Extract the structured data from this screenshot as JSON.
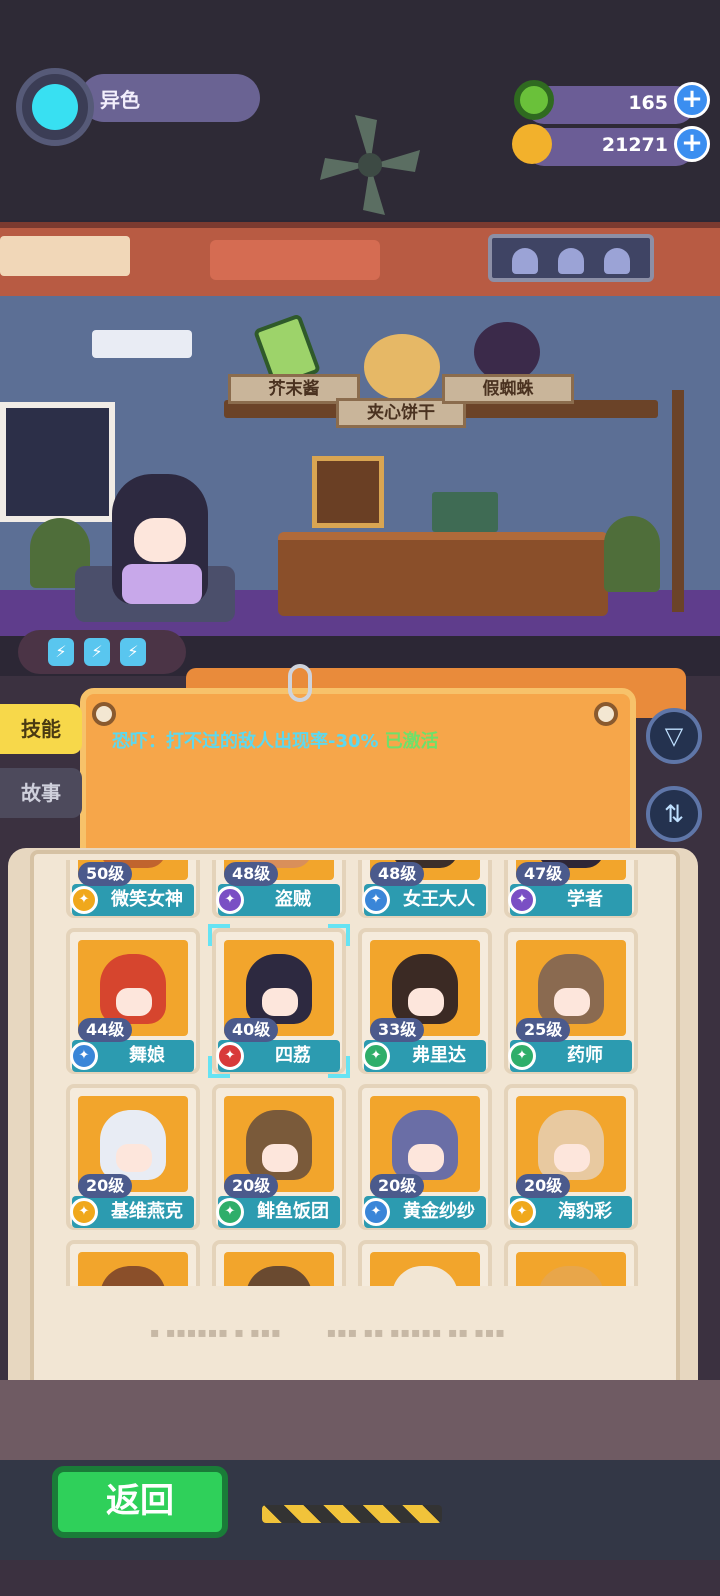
{
  "header": {
    "name": "异色",
    "resources": [
      {
        "icon": "green-donut-icon",
        "value": "165",
        "color": "#6ac13a"
      },
      {
        "icon": "coin-planet-icon",
        "value": "21271",
        "color": "#f2b12c"
      }
    ]
  },
  "room": {
    "shelf_labels": [
      "芥末酱",
      "夹心饼干",
      "假蜘蛛"
    ],
    "energy_count": 3
  },
  "side_tabs": [
    "技能",
    "故事"
  ],
  "skill": {
    "text": "恐吓：打不过的敌人出现率-30%",
    "status": "已激活"
  },
  "characters": [
    {
      "level": "50级",
      "name": "微笑女神",
      "badge": "gold"
    },
    {
      "level": "48级",
      "name": "盗贼",
      "badge": "purple"
    },
    {
      "level": "48级",
      "name": "女王大人",
      "badge": "blue"
    },
    {
      "level": "47级",
      "name": "学者",
      "badge": "purple"
    },
    {
      "level": "44级",
      "name": "舞娘",
      "badge": "blue"
    },
    {
      "level": "40级",
      "name": "四荔",
      "badge": "red",
      "selected": true
    },
    {
      "level": "33级",
      "name": "弗里达",
      "badge": "green"
    },
    {
      "level": "25级",
      "name": "药师",
      "badge": "green"
    },
    {
      "level": "20级",
      "name": "基维燕克",
      "badge": "gold"
    },
    {
      "level": "20级",
      "name": "鲱鱼饭团",
      "badge": "green"
    },
    {
      "level": "20级",
      "name": "黄金纱纱",
      "badge": "blue"
    },
    {
      "level": "20级",
      "name": "海豹彩",
      "badge": "gold"
    },
    {
      "level": "",
      "name": "",
      "badge": "none"
    },
    {
      "level": "",
      "name": "",
      "badge": "none"
    },
    {
      "level": "",
      "name": "",
      "badge": "none"
    },
    {
      "level": "",
      "name": "",
      "badge": "none"
    }
  ],
  "footer": {
    "back_label": "返回"
  }
}
